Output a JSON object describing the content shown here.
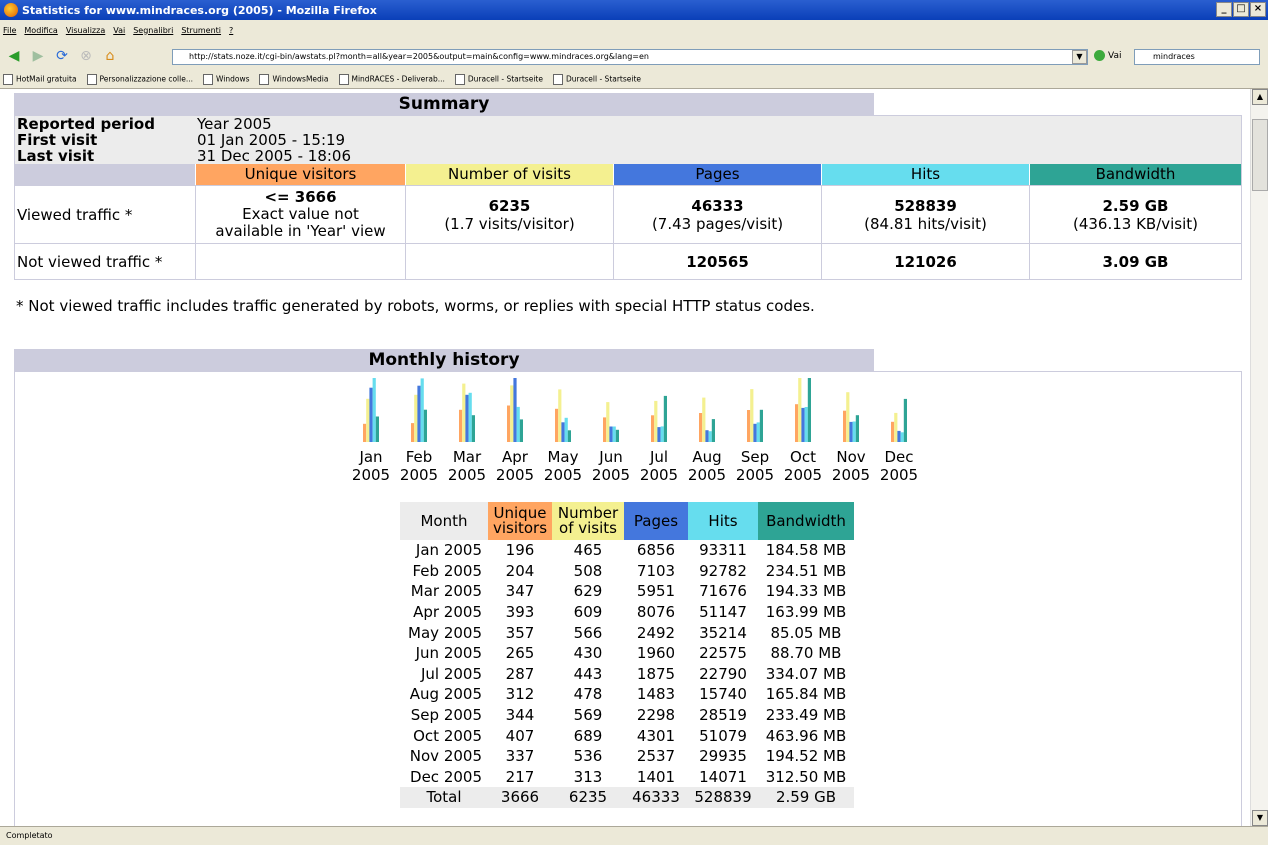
{
  "window": {
    "title": "Statistics for www.mindraces.org (2005) - Mozilla Firefox"
  },
  "menu": [
    "File",
    "Modifica",
    "Visualizza",
    "Vai",
    "Segnalibri",
    "Strumenti",
    "?"
  ],
  "nav": {
    "url": "http://stats.noze.it/cgi-bin/awstats.pl?month=all&year=2005&output=main&config=www.mindraces.org&lang=en",
    "go_label": "Vai",
    "search_value": "mindraces"
  },
  "bookmarks": [
    "HotMail gratuita",
    "Personalizzazione colle...",
    "Windows",
    "WindowsMedia",
    "MindRACES - Deliverab...",
    "Duracell - Startseite",
    "Duracell - Startseite"
  ],
  "status": "Completato",
  "summary": {
    "heading": "Summary",
    "reported_period_label": "Reported period",
    "reported_period_value": "Year 2005",
    "first_visit_label": "First visit",
    "first_visit_value": "01 Jan 2005 - 15:19",
    "last_visit_label": "Last visit",
    "last_visit_value": "31 Dec 2005 - 18:06",
    "cols": {
      "unique": "Unique visitors",
      "visits": "Number of visits",
      "pages": "Pages",
      "hits": "Hits",
      "bandwidth": "Bandwidth"
    },
    "colors": {
      "unique": "#ffa561",
      "visits": "#f4f090",
      "pages": "#4477dd",
      "hits": "#66ddee",
      "bandwidth": "#2ea495"
    },
    "viewed": {
      "label": "Viewed traffic *",
      "unique": "<= 3666",
      "unique_note1": "Exact value not",
      "unique_note2": "available in 'Year' view",
      "visits": "6235",
      "visits_note": "(1.7 visits/visitor)",
      "pages": "46333",
      "pages_note": "(7.43 pages/visit)",
      "hits": "528839",
      "hits_note": "(84.81 hits/visit)",
      "bandwidth": "2.59 GB",
      "bandwidth_note": "(436.13 KB/visit)"
    },
    "not_viewed": {
      "label": "Not viewed traffic *",
      "pages": "120565",
      "hits": "121026",
      "bandwidth": "3.09 GB"
    },
    "footnote": "* Not viewed traffic includes traffic generated by robots, worms, or replies with special HTTP status codes."
  },
  "monthly": {
    "heading": "Monthly history",
    "cols": {
      "month": "Month",
      "unique1": "Unique",
      "unique2": "visitors",
      "visits1": "Number",
      "visits2": "of visits",
      "pages": "Pages",
      "hits": "Hits",
      "bandwidth": "Bandwidth"
    },
    "rows": [
      {
        "month": "Jan 2005",
        "unique": "196",
        "visits": "465",
        "pages": "6856",
        "hits": "93311",
        "bandwidth": "184.58 MB"
      },
      {
        "month": "Feb 2005",
        "unique": "204",
        "visits": "508",
        "pages": "7103",
        "hits": "92782",
        "bandwidth": "234.51 MB"
      },
      {
        "month": "Mar 2005",
        "unique": "347",
        "visits": "629",
        "pages": "5951",
        "hits": "71676",
        "bandwidth": "194.33 MB"
      },
      {
        "month": "Apr 2005",
        "unique": "393",
        "visits": "609",
        "pages": "8076",
        "hits": "51147",
        "bandwidth": "163.99 MB"
      },
      {
        "month": "May 2005",
        "unique": "357",
        "visits": "566",
        "pages": "2492",
        "hits": "35214",
        "bandwidth": "85.05 MB"
      },
      {
        "month": "Jun 2005",
        "unique": "265",
        "visits": "430",
        "pages": "1960",
        "hits": "22575",
        "bandwidth": "88.70 MB"
      },
      {
        "month": "Jul 2005",
        "unique": "287",
        "visits": "443",
        "pages": "1875",
        "hits": "22790",
        "bandwidth": "334.07 MB"
      },
      {
        "month": "Aug 2005",
        "unique": "312",
        "visits": "478",
        "pages": "1483",
        "hits": "15740",
        "bandwidth": "165.84 MB"
      },
      {
        "month": "Sep 2005",
        "unique": "344",
        "visits": "569",
        "pages": "2298",
        "hits": "28519",
        "bandwidth": "233.49 MB"
      },
      {
        "month": "Oct 2005",
        "unique": "407",
        "visits": "689",
        "pages": "4301",
        "hits": "51079",
        "bandwidth": "463.96 MB"
      },
      {
        "month": "Nov 2005",
        "unique": "337",
        "visits": "536",
        "pages": "2537",
        "hits": "29935",
        "bandwidth": "194.52 MB"
      },
      {
        "month": "Dec 2005",
        "unique": "217",
        "visits": "313",
        "pages": "1401",
        "hits": "14071",
        "bandwidth": "312.50 MB"
      }
    ],
    "total": {
      "label": "Total",
      "unique": "3666",
      "visits": "6235",
      "pages": "46333",
      "hits": "528839",
      "bandwidth": "2.59 GB"
    }
  },
  "chart_data": {
    "type": "bar",
    "categories": [
      "Jan",
      "Feb",
      "Mar",
      "Apr",
      "May",
      "Jun",
      "Jul",
      "Aug",
      "Sep",
      "Oct",
      "Nov",
      "Dec"
    ],
    "category_year": "2005",
    "series": [
      {
        "name": "Unique visitors",
        "color": "#ffa561",
        "values": [
          196,
          204,
          347,
          393,
          357,
          265,
          287,
          312,
          344,
          407,
          337,
          217
        ]
      },
      {
        "name": "Number of visits",
        "color": "#f4f090",
        "values": [
          465,
          508,
          629,
          609,
          566,
          430,
          443,
          478,
          569,
          689,
          536,
          313
        ]
      },
      {
        "name": "Pages",
        "color": "#4477dd",
        "values": [
          6856,
          7103,
          5951,
          8076,
          2492,
          1960,
          1875,
          1483,
          2298,
          4301,
          2537,
          1401
        ]
      },
      {
        "name": "Hits",
        "color": "#66ddee",
        "values": [
          93311,
          92782,
          71676,
          51147,
          35214,
          22575,
          22790,
          15740,
          28519,
          51079,
          29935,
          14071
        ]
      },
      {
        "name": "Bandwidth",
        "color": "#2ea495",
        "values": [
          184.58,
          234.51,
          194.33,
          163.99,
          85.05,
          88.7,
          334.07,
          165.84,
          233.49,
          463.96,
          194.52,
          312.5
        ]
      }
    ]
  }
}
